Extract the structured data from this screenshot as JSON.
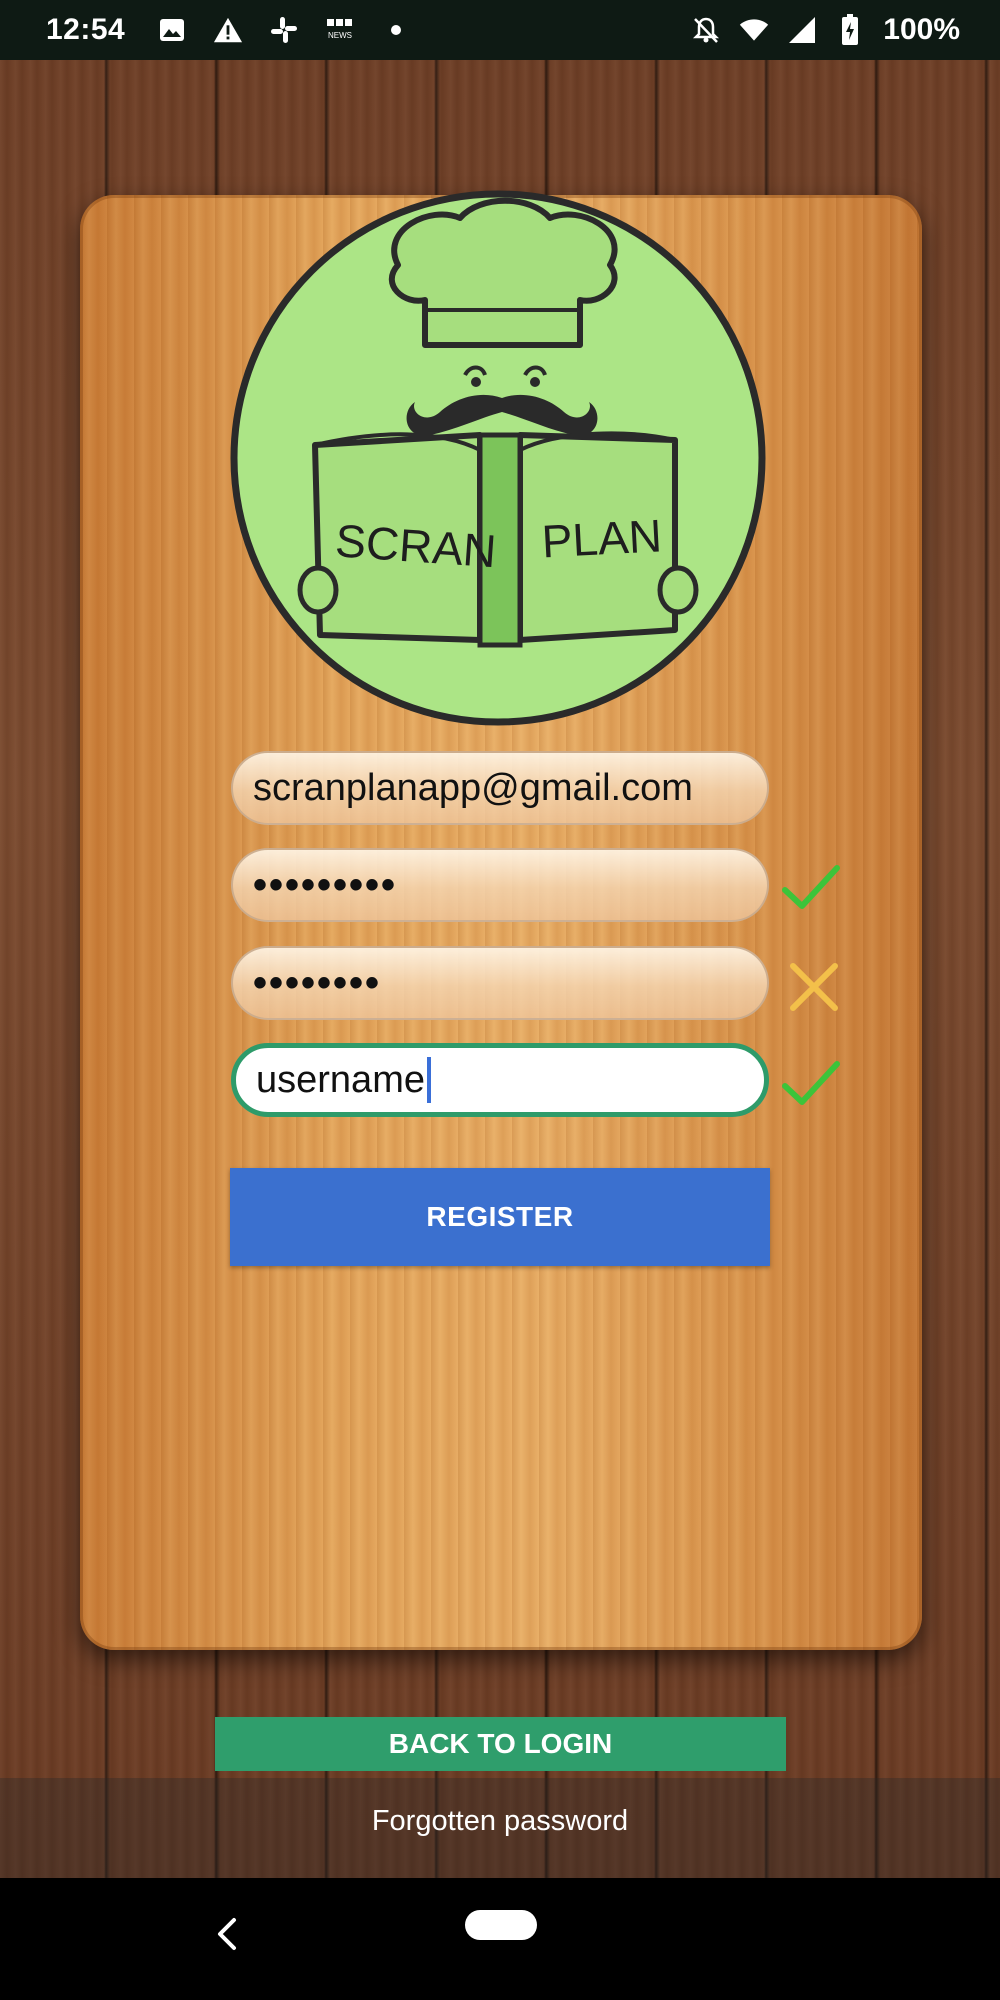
{
  "status_bar": {
    "time": "12:54",
    "battery_percent": "100%",
    "left_icons": [
      "image-icon",
      "warning-icon",
      "slack-icon",
      "bbc-news-icon",
      "dot-icon"
    ],
    "right_icons": [
      "notifications-off-icon",
      "wifi-icon",
      "signal-icon",
      "battery-icon"
    ]
  },
  "logo": {
    "text_left": "SCRAN",
    "text_right": "PLAN",
    "circle_color": "#acE586"
  },
  "form": {
    "email_value": "scranplanapp@gmail.com",
    "password_value": "•••••••••",
    "confirm_password_value": "••••••••",
    "username_value": "username",
    "password_status": "valid",
    "confirm_status": "invalid",
    "username_status": "valid"
  },
  "buttons": {
    "register_label": "REGISTER",
    "back_to_login_label": "BACK TO LOGIN",
    "forgotten_password_label": "Forgotten password"
  },
  "colors": {
    "register": "#3b70cf",
    "back_to_login": "#2f9e6c",
    "valid": "#3cc43a",
    "invalid": "#f3c04a"
  },
  "nav_bar": {
    "icons": [
      "back-icon",
      "home-pill-icon"
    ]
  }
}
